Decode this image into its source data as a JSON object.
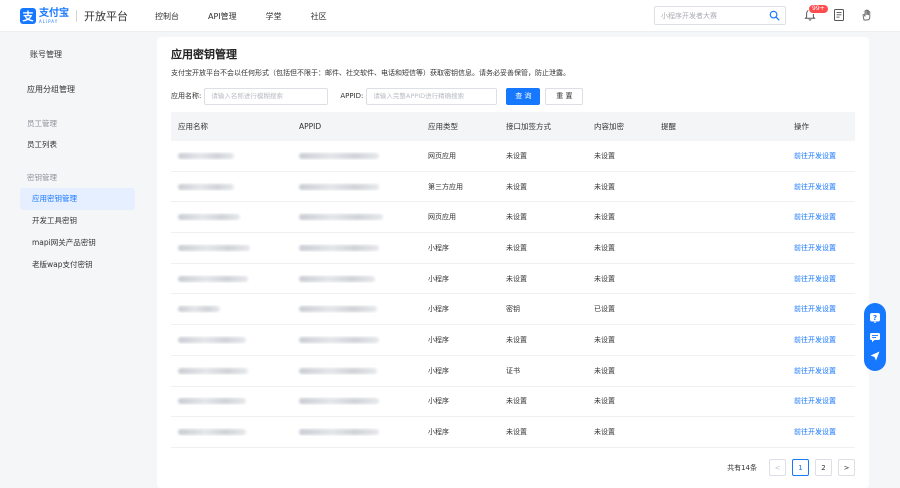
{
  "header": {
    "logo_mark": "支",
    "logo_cn": "支付宝",
    "logo_en": "ALIPAY",
    "platform_title": "开放平台",
    "nav": [
      "控制台",
      "API管理",
      "学堂",
      "社区"
    ],
    "search_placeholder": "小程序开发者大赛",
    "badge": "99+",
    "icons": [
      "search-icon",
      "bell-icon",
      "document-icon",
      "hand-icon"
    ]
  },
  "sidebar": {
    "top_links": [
      "账号管理",
      "应用分组管理"
    ],
    "groups": [
      {
        "title": "员工管理",
        "items": [
          "员工列表"
        ]
      },
      {
        "title": "密钥管理",
        "items": [
          "应用密钥管理",
          "开发工具密钥",
          "mapi网关产品密钥",
          "老版wap支付密钥"
        ]
      }
    ],
    "active_item": "应用密钥管理"
  },
  "main": {
    "title": "应用密钥管理",
    "description": "支付宝开放平台不会以任何形式（包括但不限于：邮件、社交软件、电话和短信等）获取密钥信息。请务必妥善保管，防止泄露。",
    "filters": {
      "app_name_label": "应用名称:",
      "app_name_placeholder": "请输入名称进行模糊搜索",
      "appid_label": "APPID:",
      "appid_placeholder": "请输入完整APPID进行精确搜索",
      "search_button": "查 询",
      "reset_button": "重 置"
    },
    "table": {
      "columns": [
        "应用名称",
        "APPID",
        "应用类型",
        "接口加签方式",
        "内容加密",
        "提醒",
        "操作"
      ],
      "rows": [
        {
          "type": "网页应用",
          "sign": "未设置",
          "encrypt": "未设置",
          "reminder": "",
          "action": "前往开发设置"
        },
        {
          "type": "第三方应用",
          "sign": "未设置",
          "encrypt": "未设置",
          "reminder": "",
          "action": "前往开发设置"
        },
        {
          "type": "网页应用",
          "sign": "未设置",
          "encrypt": "未设置",
          "reminder": "",
          "action": "前往开发设置"
        },
        {
          "type": "小程序",
          "sign": "未设置",
          "encrypt": "未设置",
          "reminder": "",
          "action": "前往开发设置"
        },
        {
          "type": "小程序",
          "sign": "未设置",
          "encrypt": "未设置",
          "reminder": "",
          "action": "前往开发设置"
        },
        {
          "type": "小程序",
          "sign": "密钥",
          "encrypt": "已设置",
          "reminder": "",
          "action": "前往开发设置"
        },
        {
          "type": "小程序",
          "sign": "未设置",
          "encrypt": "未设置",
          "reminder": "",
          "action": "前往开发设置"
        },
        {
          "type": "小程序",
          "sign": "证书",
          "encrypt": "未设置",
          "reminder": "",
          "action": "前往开发设置"
        },
        {
          "type": "小程序",
          "sign": "未设置",
          "encrypt": "未设置",
          "reminder": "",
          "action": "前往开发设置"
        },
        {
          "type": "小程序",
          "sign": "未设置",
          "encrypt": "未设置",
          "reminder": "",
          "action": "前往开发设置"
        }
      ]
    },
    "pagination": {
      "total": "共有14条",
      "prev": "<",
      "pages": [
        "1",
        "2"
      ],
      "current": "1",
      "next": ">"
    }
  },
  "float_toolbar": {
    "icons": [
      "help-icon",
      "chat-icon",
      "feedback-icon"
    ]
  },
  "colors": {
    "accent": "#1677ff",
    "badge": "#ff4d4f",
    "background": "#f5f6f8"
  }
}
